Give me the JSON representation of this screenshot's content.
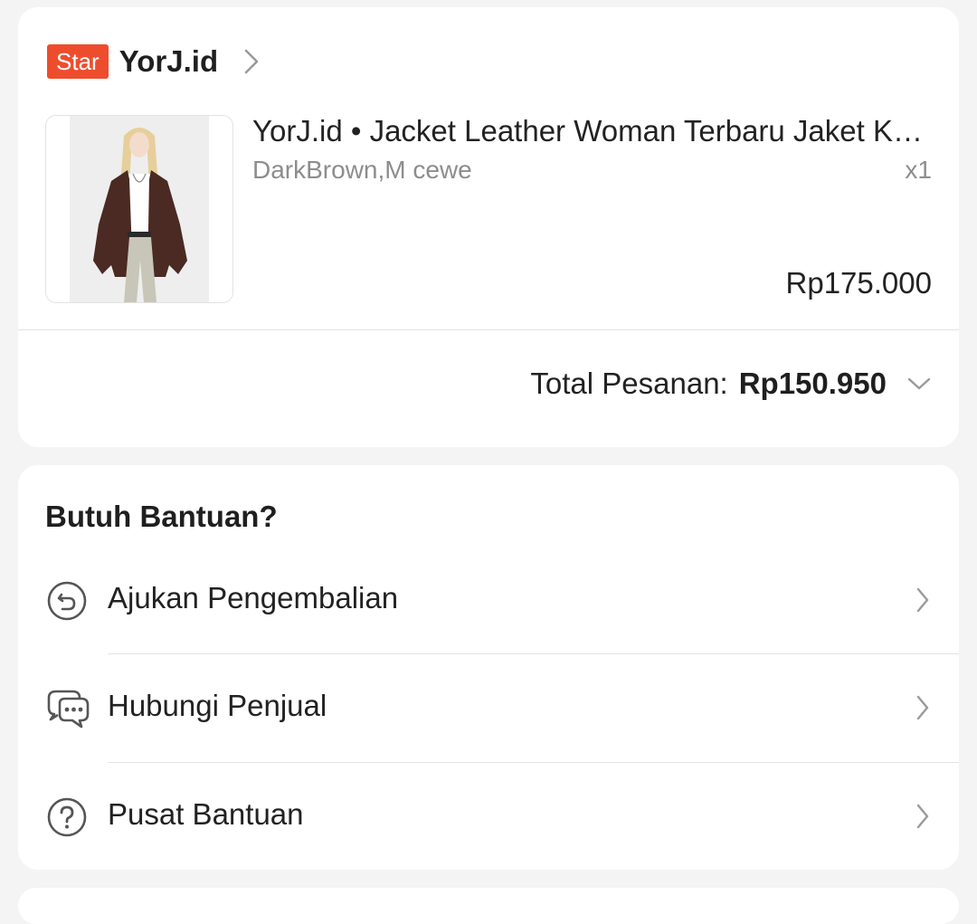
{
  "order": {
    "shop": {
      "badge": "Star",
      "name": "YorJ.id"
    },
    "product": {
      "title": "YorJ.id • Jacket Leather Woman Terbaru Jaket Kulit Oversize Wanita",
      "variant": "DarkBrown,M cewe",
      "quantity": "x1",
      "price": "Rp175.000"
    },
    "total_label": "Total Pesanan:",
    "total_value": "Rp150.950"
  },
  "help": {
    "title": "Butuh Bantuan?",
    "items": [
      {
        "label": "Ajukan Pengembalian",
        "icon": "return-icon"
      },
      {
        "label": "Hubungi Penjual",
        "icon": "chat-icon"
      },
      {
        "label": "Pusat Bantuan",
        "icon": "help-circle-icon"
      }
    ]
  },
  "colors": {
    "brand": "#ee4d2d",
    "background": "#f4f4f4",
    "muted_text": "#8d8d8d"
  }
}
